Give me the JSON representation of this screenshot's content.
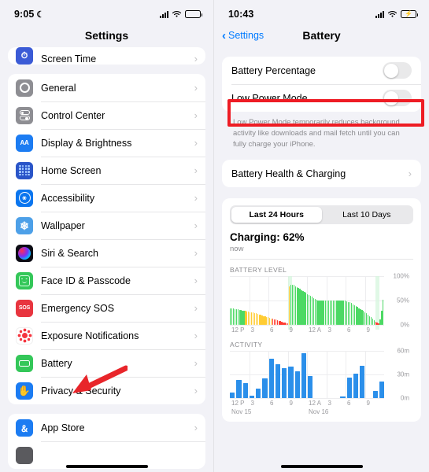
{
  "left": {
    "status": {
      "time": "9:05",
      "moon_icon": "crescent-moon-icon",
      "signal_icon": "cellular-signal-icon",
      "wifi_icon": "wifi-icon",
      "battery_icon": "battery-icon"
    },
    "nav_title": "Settings",
    "group_partial": [
      {
        "label": "Screen Time",
        "icon": "screen-time-icon"
      }
    ],
    "group_main": [
      {
        "label": "General",
        "icon": "gear-icon"
      },
      {
        "label": "Control Center",
        "icon": "control-center-icon"
      },
      {
        "label": "Display & Brightness",
        "icon": "display-brightness-icon"
      },
      {
        "label": "Home Screen",
        "icon": "home-screen-icon"
      },
      {
        "label": "Accessibility",
        "icon": "accessibility-icon"
      },
      {
        "label": "Wallpaper",
        "icon": "wallpaper-icon"
      },
      {
        "label": "Siri & Search",
        "icon": "siri-icon"
      },
      {
        "label": "Face ID & Passcode",
        "icon": "face-id-icon"
      },
      {
        "label": "Emergency SOS",
        "icon": "emergency-sos-icon"
      },
      {
        "label": "Exposure Notifications",
        "icon": "exposure-notifications-icon"
      },
      {
        "label": "Battery",
        "icon": "battery-settings-icon"
      },
      {
        "label": "Privacy & Security",
        "icon": "privacy-security-icon"
      }
    ],
    "group_store": [
      {
        "label": "App Store",
        "icon": "app-store-icon"
      }
    ],
    "chevron": "›",
    "annotation": {
      "arrow": "red-arrow-pointing-to-battery",
      "color": "#e8252a"
    }
  },
  "right": {
    "status": {
      "time": "10:43",
      "signal_icon": "cellular-signal-icon",
      "wifi_icon": "wifi-icon",
      "battery_icon": "battery-charging-icon"
    },
    "nav_title": "Battery",
    "back_label": "Settings",
    "back_icon": "chevron-left-icon",
    "toggles": [
      {
        "label": "Battery Percentage",
        "state": "off"
      },
      {
        "label": "Low Power Mode",
        "state": "off"
      }
    ],
    "footnote": "Low Power Mode temporarily reduces background activity like downloads and mail fetch until you can fully charge your iPhone.",
    "health_row": {
      "label": "Battery Health & Charging",
      "chevron": "›"
    },
    "segmented": {
      "options": [
        "Last 24 Hours",
        "Last 10 Days"
      ],
      "selected": "Last 24 Hours"
    },
    "charging_title": "Charging: 62%",
    "charging_sub": "now",
    "highlight": {
      "target": "Low Power Mode",
      "color": "#ee1c24"
    }
  },
  "chart_data": [
    {
      "type": "bar",
      "title": "BATTERY LEVEL",
      "xlabel": "",
      "ylabel": "",
      "ylim": [
        0,
        100
      ],
      "ytick_labels": [
        "100%",
        "50%",
        "0%"
      ],
      "ytick_values": [
        100,
        50,
        0
      ],
      "xtick_labels": [
        "12 P",
        "3",
        "6",
        "9",
        "12 A",
        "3",
        "6",
        "9"
      ],
      "grid": true,
      "legend": "none",
      "colors": {
        "normal": "#4cd964",
        "low_power": "#ffcc33",
        "critical": "#ff3b30",
        "charging_highlight": "#d6f5dd"
      },
      "values": [
        35,
        34,
        34,
        33,
        33,
        32,
        31,
        31,
        30,
        30,
        29,
        28,
        28,
        27,
        26,
        26,
        25,
        24,
        23,
        22,
        21,
        20,
        19,
        18,
        17,
        16,
        15,
        14,
        13,
        12,
        11,
        10,
        9,
        8,
        7,
        6,
        5,
        4,
        3,
        80,
        82,
        83,
        82,
        80,
        78,
        76,
        74,
        72,
        70,
        68,
        66,
        64,
        62,
        60,
        58,
        56,
        54,
        52,
        51,
        50,
        50,
        50,
        50,
        50,
        50,
        50,
        50,
        50,
        50,
        50,
        50,
        50,
        50,
        50,
        50,
        50,
        50,
        49,
        48,
        47,
        45,
        43,
        41,
        39,
        37,
        35,
        33,
        31,
        29,
        27,
        25,
        22,
        19,
        16,
        13,
        10,
        7,
        5,
        3,
        12,
        30,
        52
      ],
      "states": [
        "n",
        "n",
        "n",
        "n",
        "n",
        "n",
        "n",
        "n",
        "n",
        "n",
        "lp",
        "lp",
        "lp",
        "lp",
        "lp",
        "lp",
        "lp",
        "lp",
        "lp",
        "lp",
        "lp",
        "lp",
        "lp",
        "lp",
        "lp",
        "lp",
        "lp",
        "lp",
        "c",
        "c",
        "c",
        "c",
        "c",
        "c",
        "c",
        "c",
        "c",
        "c",
        "c",
        "lp",
        "n",
        "n",
        "n",
        "n",
        "n",
        "n",
        "n",
        "n",
        "n",
        "n",
        "n",
        "n",
        "n",
        "n",
        "n",
        "n",
        "n",
        "n",
        "n",
        "n",
        "n",
        "n",
        "n",
        "n",
        "n",
        "n",
        "n",
        "n",
        "n",
        "n",
        "n",
        "n",
        "n",
        "n",
        "n",
        "n",
        "n",
        "n",
        "n",
        "n",
        "n",
        "n",
        "n",
        "n",
        "n",
        "n",
        "n",
        "n",
        "n",
        "n",
        "n",
        "n",
        "n",
        "n",
        "n",
        "n",
        "c",
        "c",
        "c",
        "n",
        "n",
        "n"
      ],
      "charge_markers": [
        39,
        97
      ]
    },
    {
      "type": "bar",
      "title": "ACTIVITY",
      "xlabel": "",
      "ylabel": "",
      "ylim": [
        0,
        60
      ],
      "ytick_labels": [
        "60m",
        "30m",
        "0m"
      ],
      "ytick_values": [
        60,
        30,
        0
      ],
      "xtick_labels": [
        "12 P",
        "3",
        "6",
        "9",
        "12 A",
        "3",
        "6",
        "9"
      ],
      "date_labels": [
        "Nov 15",
        "Nov 16"
      ],
      "grid": true,
      "legend": "none",
      "colors": {
        "screen_on": "#2b8fea"
      },
      "categories": [
        "12 P",
        "1",
        "2",
        "3",
        "4",
        "5",
        "6",
        "7",
        "8",
        "9",
        "10",
        "11",
        "12 A",
        "1",
        "2",
        "3",
        "4",
        "5",
        "6",
        "7",
        "8",
        "9",
        "10",
        "11"
      ],
      "values": [
        7,
        23,
        19,
        3,
        12,
        25,
        50,
        43,
        38,
        40,
        34,
        57,
        28,
        0,
        0,
        0,
        0,
        2,
        26,
        31,
        41,
        0,
        9,
        21
      ]
    }
  ]
}
